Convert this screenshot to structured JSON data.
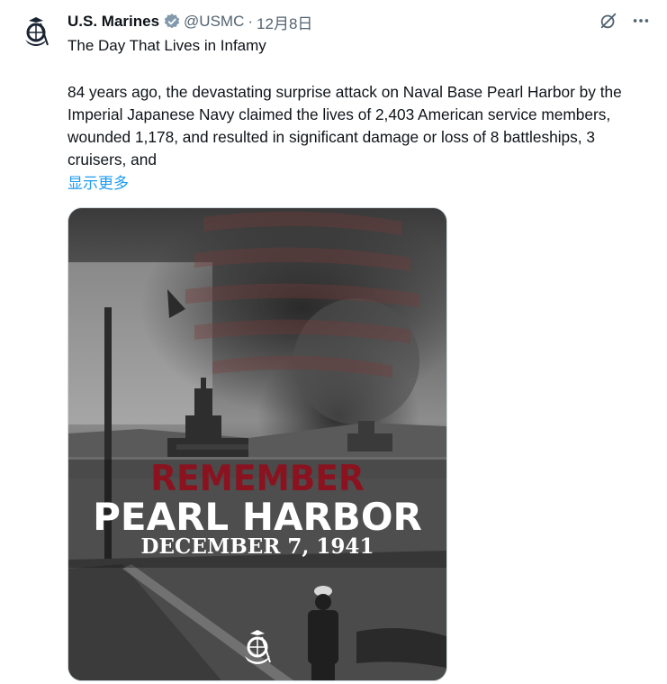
{
  "post": {
    "display_name": "U.S. Marines",
    "handle": "@USMC",
    "separator": "·",
    "date": "12月8日",
    "subtitle": "The Day That Lives in Infamy",
    "body": "84 years ago, the devastating surprise attack on Naval Base Pearl Harbor by the Imperial Japanese Navy claimed the lives of 2,403 American service members, wounded 1,178, and resulted in significant damage or loss of 8 battleships, 3 cruisers, and",
    "show_more": "显示更多"
  },
  "icons": {
    "avatar": "usmc-emblem-icon",
    "verified": "verified-badge-icon",
    "grok": "grok-icon",
    "more": "more-options-icon"
  },
  "media": {
    "line1": "REMEMBER",
    "line2": "PEARL HARBOR",
    "line3": "DECEMBER 7, 1941"
  },
  "colors": {
    "link": "#1d9bf0",
    "verified": "#829aab",
    "remember_red": "#8b1320"
  }
}
